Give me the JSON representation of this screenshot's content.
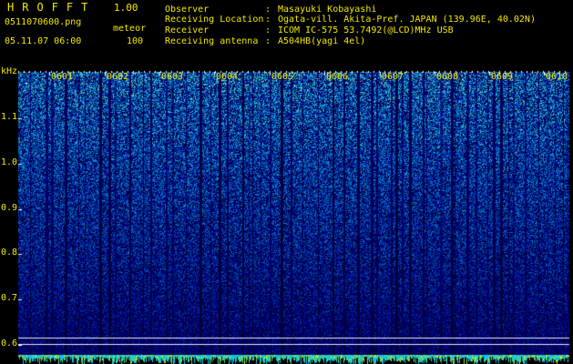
{
  "header": {
    "app_name": "HROFFT",
    "version": "1.00",
    "filename": "0511070600.png",
    "datetime": "05.11.07 06:00",
    "mode": "meteor",
    "count": "100"
  },
  "info": [
    {
      "key": "Observer",
      "value": "Masayuki Kobayashi"
    },
    {
      "key": "Receiving Location",
      "value": "Ogata-vill. Akita-Pref. JAPAN (139.96E, 40.02N)"
    },
    {
      "key": "Receiver",
      "value": "ICOM IC-575 53.7492(@LCD)MHz USB"
    },
    {
      "key": "Receiving antenna",
      "value": "A504HB(yagi 4el)"
    }
  ],
  "separator": ":",
  "plot": {
    "y_unit": "kHz",
    "y_ticks": [
      "1.1",
      "1.0",
      "0.9",
      "0.8",
      "0.7",
      "0.6"
    ],
    "x_ticks": [
      "0601",
      "0602",
      "0603",
      "0604",
      "0605",
      "0606",
      "0607",
      "0608",
      "0609",
      "0610"
    ],
    "colors": {
      "text": "#f2e800",
      "background": "#000000",
      "noise_low": "#0a1a9a",
      "noise_high": "#44e8d0",
      "ticks": "#ffffff"
    }
  }
}
